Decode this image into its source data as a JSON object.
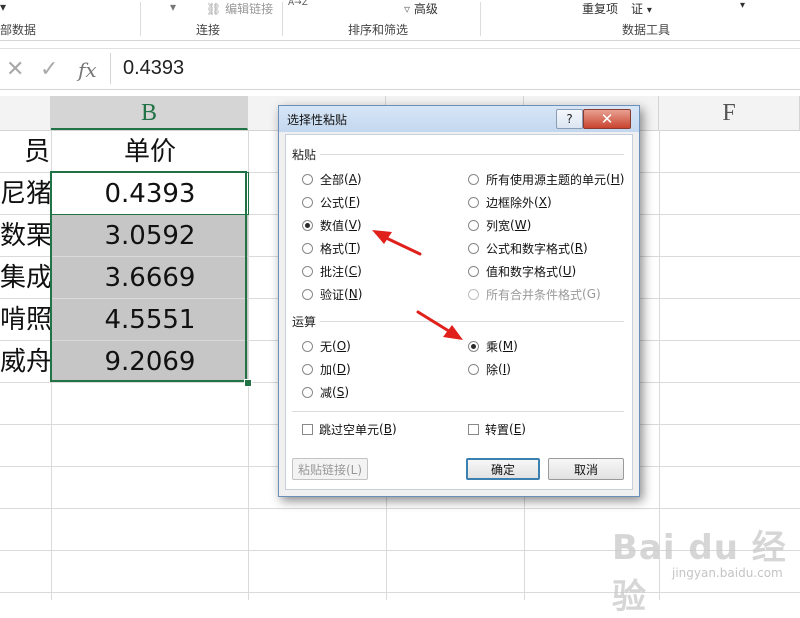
{
  "ribbon": {
    "group_left": "部数据",
    "edit_links": "编辑链接",
    "group_connections": "连接",
    "sort_icon": "A→Z",
    "advanced": "高级",
    "group_sort_filter": "排序和筛选",
    "remove_duplicates": "重复项",
    "validation": "证",
    "group_data_tools": "数据工具"
  },
  "formula_bar": {
    "cancel_icon": "✕",
    "enter_icon": "✓",
    "fx": "fx",
    "value": "0.4393"
  },
  "grid": {
    "column_headers": {
      "B": "B",
      "F": "F"
    },
    "col_a_partials": [
      "员",
      "尼猪",
      "数栗",
      "集成",
      "啃照",
      "威舟"
    ],
    "b_header": "单价",
    "b_values": [
      "0.4393",
      "3.0592",
      "3.6669",
      "4.5551",
      "9.2069"
    ]
  },
  "dialog": {
    "title": "选择性粘贴",
    "help": "?",
    "close": "✕",
    "paste_section": "粘贴",
    "paste_options_left": [
      {
        "label": "全部",
        "key": "A",
        "checked": false
      },
      {
        "label": "公式",
        "key": "F",
        "checked": false
      },
      {
        "label": "数值",
        "key": "V",
        "checked": true
      },
      {
        "label": "格式",
        "key": "T",
        "checked": false
      },
      {
        "label": "批注",
        "key": "C",
        "checked": false
      },
      {
        "label": "验证",
        "key": "N",
        "checked": false
      }
    ],
    "paste_options_right": [
      {
        "label": "所有使用源主题的单元",
        "key": "H",
        "checked": false,
        "disabled": false
      },
      {
        "label": "边框除外",
        "key": "X",
        "checked": false,
        "disabled": false
      },
      {
        "label": "列宽",
        "key": "W",
        "checked": false,
        "disabled": false
      },
      {
        "label": "公式和数字格式",
        "key": "R",
        "checked": false,
        "disabled": false
      },
      {
        "label": "值和数字格式",
        "key": "U",
        "checked": false,
        "disabled": false
      },
      {
        "label": "所有合并条件格式",
        "key": "G",
        "checked": false,
        "disabled": true
      }
    ],
    "operation_section": "运算",
    "operation_left": [
      {
        "label": "无",
        "key": "O",
        "checked": false
      },
      {
        "label": "加",
        "key": "D",
        "checked": false
      },
      {
        "label": "减",
        "key": "S",
        "checked": false
      }
    ],
    "operation_right": [
      {
        "label": "乘",
        "key": "M",
        "checked": true
      },
      {
        "label": "除",
        "key": "I",
        "checked": false
      }
    ],
    "skip_blanks": {
      "label": "跳过空单元",
      "key": "B"
    },
    "transpose": {
      "label": "转置",
      "key": "E"
    },
    "paste_link": "粘贴链接(L)",
    "ok": "确定",
    "cancel": "取消"
  },
  "watermark": {
    "main": "Bai du 经验",
    "sub": "jingyan.baidu.com"
  },
  "colors": {
    "accent_green": "#217346",
    "arrow_red": "#e0201b",
    "selected_gray": "#c6c6c6"
  }
}
